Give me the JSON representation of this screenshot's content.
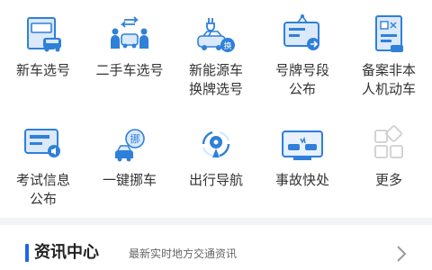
{
  "services": [
    {
      "label": "新车选号",
      "icon": "new-car-plate-icon"
    },
    {
      "label": "二手车选号",
      "icon": "used-car-plate-icon"
    },
    {
      "label": "新能源车\n换牌选号",
      "icon": "ev-car-icon"
    },
    {
      "label": "号牌号段\n公布",
      "icon": "plate-range-icon"
    },
    {
      "label": "备案非本\n人机动车",
      "icon": "vehicle-registration-icon"
    },
    {
      "label": "考试信息\n公布",
      "icon": "exam-info-icon"
    },
    {
      "label": "一键挪车",
      "icon": "move-car-icon"
    },
    {
      "label": "出行导航",
      "icon": "navigation-icon"
    },
    {
      "label": "事故快处",
      "icon": "accident-icon"
    },
    {
      "label": "更多",
      "icon": "more-grid-icon"
    }
  ],
  "news": {
    "title": "资讯中心",
    "subtitle": "最新实时地方交通资讯"
  },
  "colors": {
    "accent": "#1e66e8",
    "icon_blue": "#2f80d9",
    "icon_light": "#dbe9fb"
  }
}
